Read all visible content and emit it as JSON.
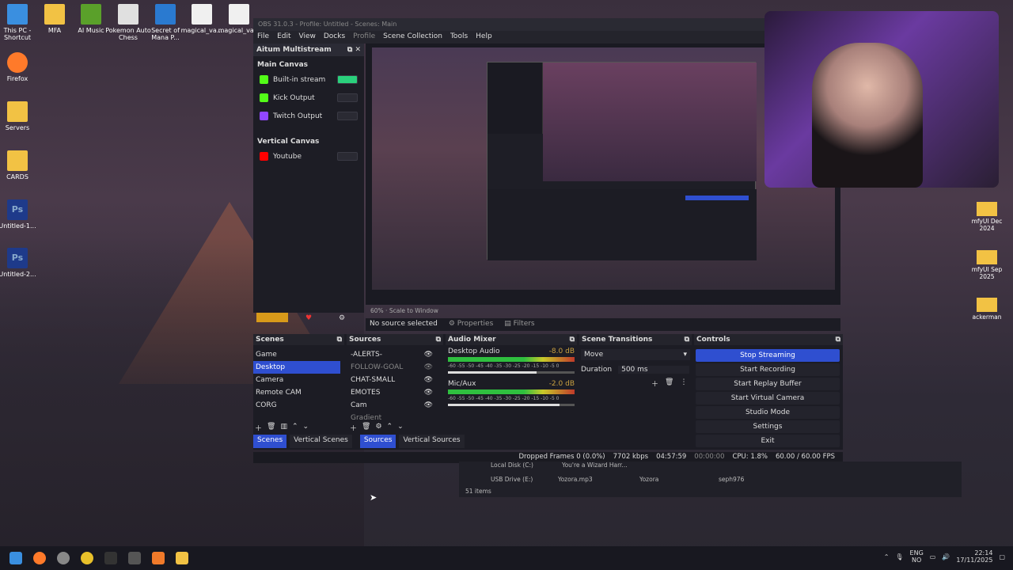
{
  "desktop_left": [
    {
      "label": "This PC - Shortcut",
      "color": "#3a8fe0"
    },
    {
      "label": "Firefox",
      "color": "#ff7a2a"
    },
    {
      "label": "Servers",
      "color": "#f2c244"
    },
    {
      "label": "CARDS",
      "color": "#f2c244"
    },
    {
      "label": "Untitled-1...",
      "color": "#1e3a8a"
    },
    {
      "label": "Untitled-2...",
      "color": "#1e3a8a"
    }
  ],
  "desktop_top": [
    {
      "label": "MFA",
      "color": "#f2c244"
    },
    {
      "label": "AI Music",
      "color": "#5aa02a"
    },
    {
      "label": "Pokemon Auto Chess",
      "color": "#e0e0e0"
    },
    {
      "label": "Secret of Mana P...",
      "color": "#2a7ad0"
    },
    {
      "label": "magical_va...",
      "color": "#f0f0f0"
    },
    {
      "label": "magical_va...",
      "color": "#f0f0f0"
    }
  ],
  "desktop_right": [
    {
      "label": "mfyUI Dec 2024"
    },
    {
      "label": "mfyUI Sep 2025"
    },
    {
      "label": "ackerman"
    }
  ],
  "obs": {
    "title": "OBS 31.0.3 - Profile: Untitled - Scenes: Main",
    "menu": [
      "File",
      "Edit",
      "View",
      "Docks",
      "Profile",
      "Scene Collection",
      "Tools",
      "Help"
    ],
    "multistream": {
      "title": "Aitum Multistream",
      "main_canvas": "Main Canvas",
      "outputs": [
        {
          "label": "Built-in stream",
          "color": "#53fc18",
          "on": true
        },
        {
          "label": "Kick Output",
          "color": "#53fc18",
          "on": false
        },
        {
          "label": "Twitch Output",
          "color": "#9146ff",
          "on": false
        }
      ],
      "vertical_canvas": "Vertical Canvas",
      "vertical_outputs": [
        {
          "label": "Youtube",
          "color": "#ff0000",
          "on": false
        }
      ]
    },
    "preview_zoom": "60%",
    "scale_mode": "Scale to Window",
    "no_source": "No source selected",
    "properties": "Properties",
    "filters": "Filters",
    "scenes": {
      "title": "Scenes",
      "items": [
        "Game",
        "Desktop",
        "Camera",
        "Remote CAM",
        "CORG"
      ],
      "selected": 1
    },
    "sources": {
      "title": "Sources",
      "items": [
        "-ALERTS-",
        "FOLLOW-GOAL",
        "CHAT-SMALL",
        "EMOTES",
        "Cam",
        "Gradient"
      ]
    },
    "mixer": {
      "title": "Audio Mixer",
      "channels": [
        {
          "name": "Desktop Audio",
          "db": "-8.0 dB",
          "level": 0.62
        },
        {
          "name": "Mic/Aux",
          "db": "-2.0 dB",
          "level": 0.85
        }
      ],
      "scale": "-60 -55 -50 -45 -40 -35 -30 -25 -20 -15 -10 -5 0"
    },
    "transitions": {
      "title": "Scene Transitions",
      "type": "Move",
      "duration_label": "Duration",
      "duration": "500 ms"
    },
    "controls": {
      "title": "Controls",
      "buttons": [
        "Stop Streaming",
        "Start Recording",
        "Start Replay Buffer",
        "Start Virtual Camera",
        "Studio Mode",
        "Settings",
        "Exit"
      ]
    },
    "tabs": [
      "Scenes",
      "Vertical Scenes",
      "Sources",
      "Vertical Sources"
    ],
    "status": {
      "dropped": "Dropped Frames 0 (0.0%)",
      "kbps": "7702 kbps",
      "stream_time": "04:57:59",
      "rec_time": "00:00:00",
      "cpu": "CPU: 1.8%",
      "fps": "60.00 / 60.00 FPS"
    }
  },
  "explorer": {
    "row1": "Local Disk (C:)",
    "row2": "USB Drive (E:)",
    "file": "Yozora.mp3",
    "artist": "Yozora",
    "owner": "seph976",
    "count": "51 items",
    "other": "You're a Wizard Harr...",
    "other_owner": "seph976"
  },
  "taskbar": {
    "lang": "ENG",
    "region": "NO",
    "time": "22:14",
    "date": "17/11/2025"
  }
}
